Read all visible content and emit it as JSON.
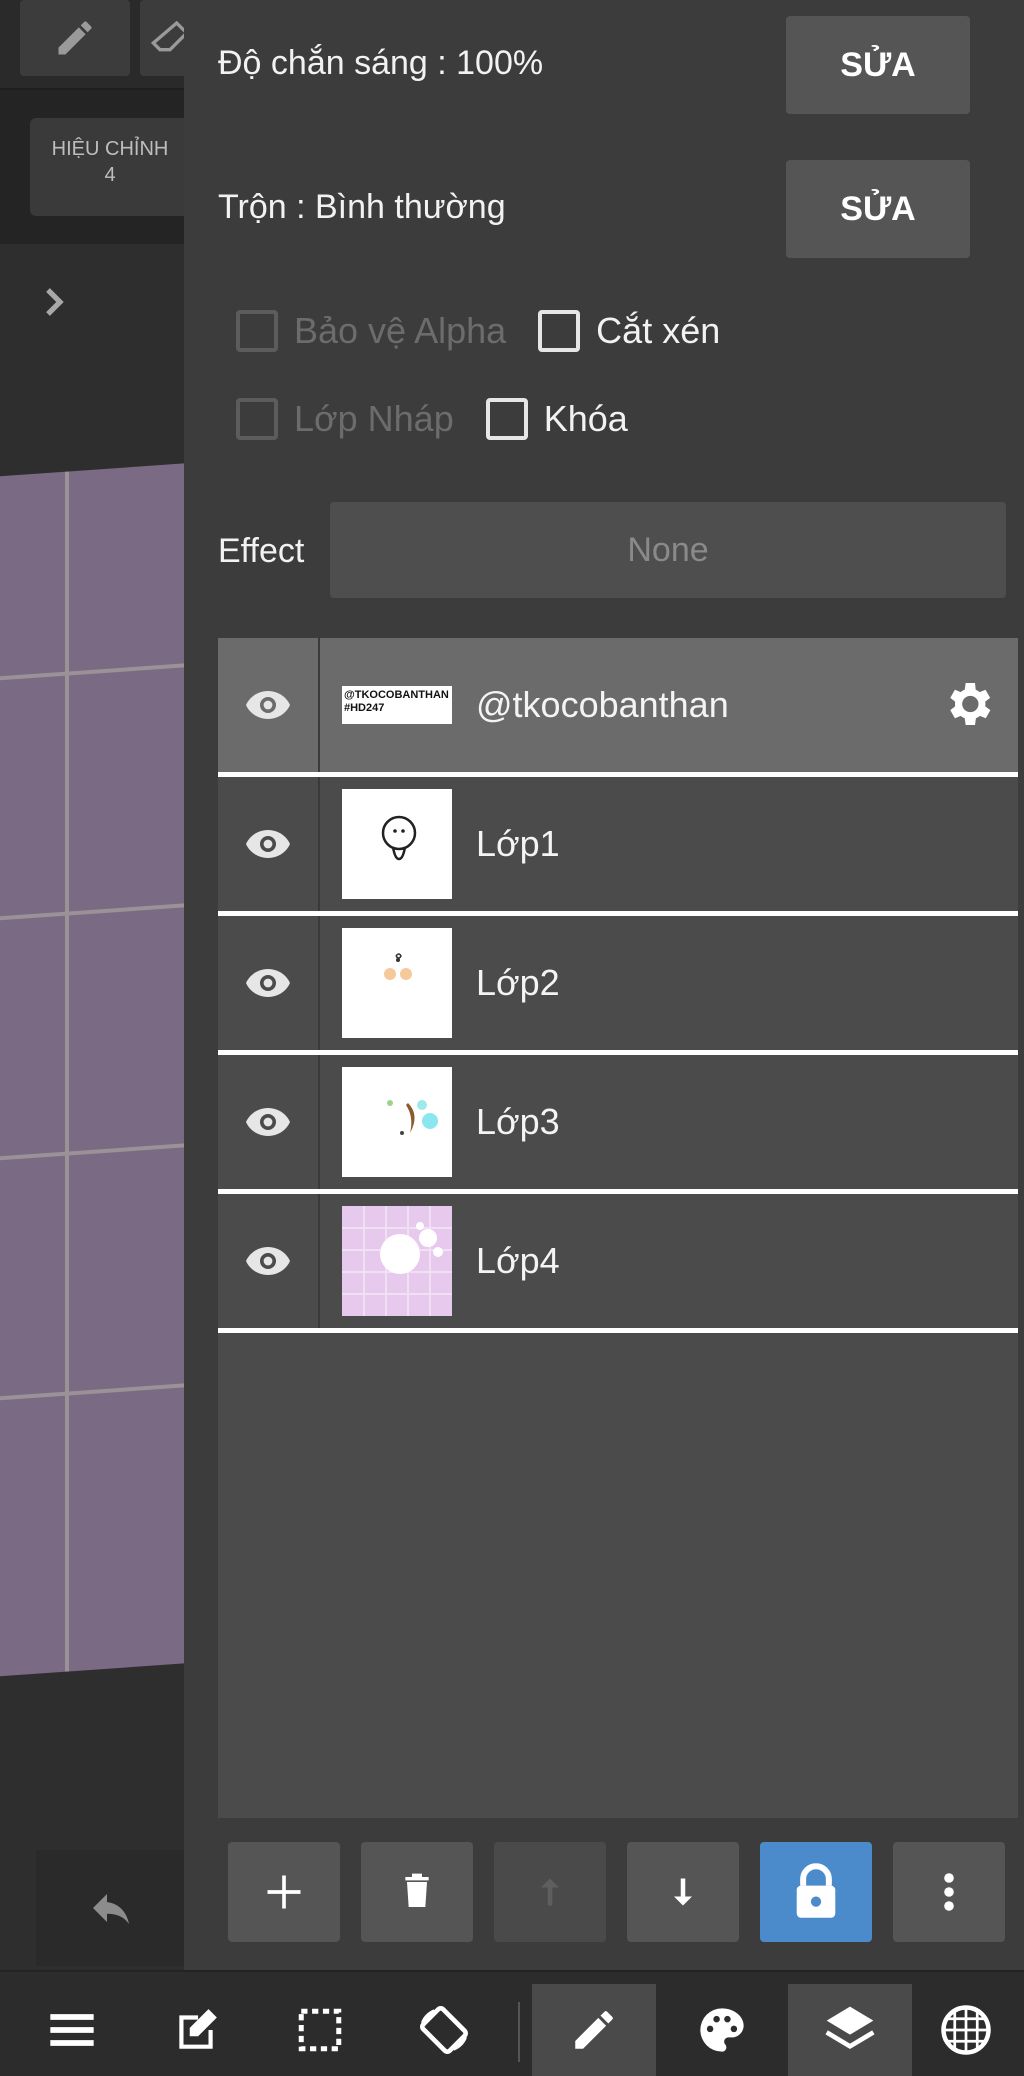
{
  "canvas": {
    "adjust_button": {
      "line1": "HIỆU CHỈNH",
      "line2": "4"
    }
  },
  "layer_properties": {
    "opacity_label": "Độ chắn sáng : 100%",
    "opacity_edit": "SỬA",
    "blend_label": "Trộn : Bình thường",
    "blend_edit": "SỬA",
    "protect_alpha": "Bảo vệ Alpha",
    "clipping": "Cắt xén",
    "draft_layer": "Lớp Nháp",
    "lock": "Khóa",
    "effect_label": "Effect",
    "effect_value": "None"
  },
  "layers": [
    {
      "name": "@tkocobanthan",
      "thumb_text_1": "@TKOCOBANTHAN",
      "thumb_text_2": "#HD247",
      "selected": true
    },
    {
      "name": "Lớp1",
      "selected": false
    },
    {
      "name": "Lớp2",
      "selected": false
    },
    {
      "name": "Lớp3",
      "selected": false
    },
    {
      "name": "Lớp4",
      "selected": false
    }
  ],
  "colors": {
    "panel_bg": "#3c3c3c",
    "selected_row": "#6b6b6b",
    "lock_active": "#4b8bcc",
    "canvas_paper": "#7a6a83"
  }
}
